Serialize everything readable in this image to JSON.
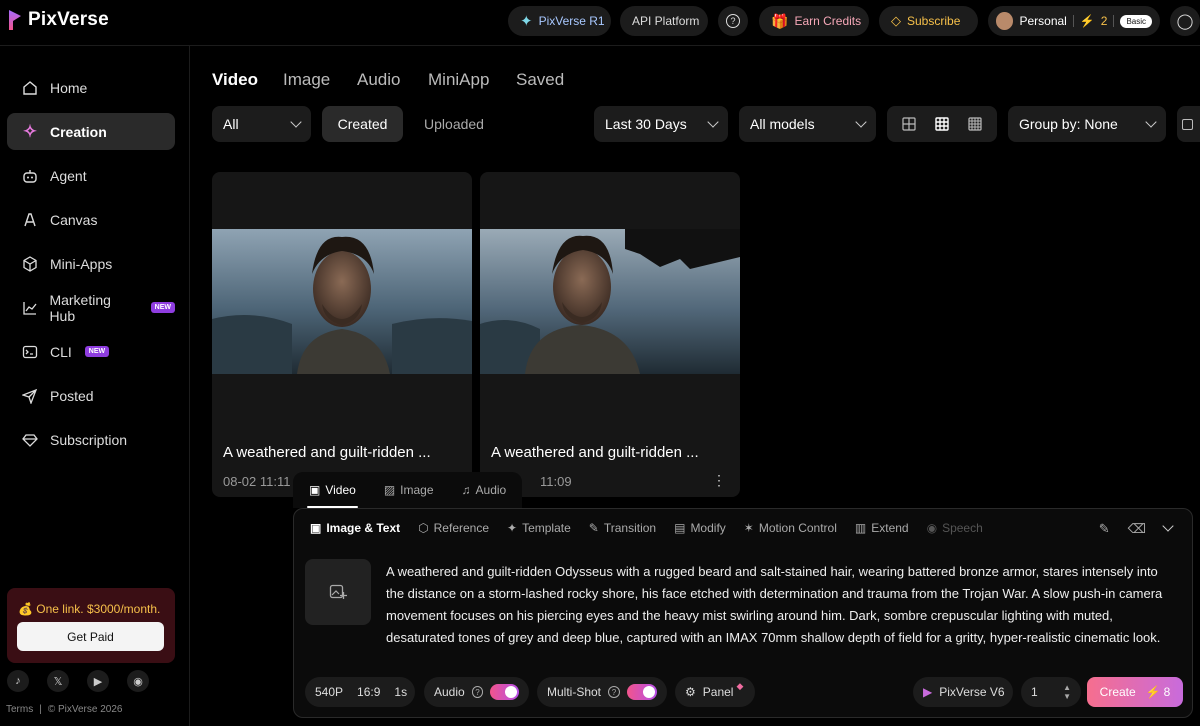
{
  "header": {
    "brand": "PixVerse",
    "r1_label": "PixVerse R1",
    "api_label": "API Platform",
    "help_label": "?",
    "earn_label": "Earn Credits",
    "subscribe_label": "Subscribe",
    "account_label": "Personal",
    "credits": "2",
    "plan_badge": "Basic"
  },
  "sidebar": {
    "items": [
      {
        "label": "Home",
        "icon": "home-icon"
      },
      {
        "label": "Creation",
        "icon": "sparkle-icon"
      },
      {
        "label": "Agent",
        "icon": "robot-icon"
      },
      {
        "label": "Canvas",
        "icon": "canvas-icon"
      },
      {
        "label": "Mini-Apps",
        "icon": "cube-icon"
      },
      {
        "label": "Marketing Hub",
        "icon": "chart-icon",
        "badge": "NEW"
      },
      {
        "label": "CLI",
        "icon": "terminal-icon",
        "badge": "NEW"
      },
      {
        "label": "Posted",
        "icon": "send-icon"
      },
      {
        "label": "Subscription",
        "icon": "diamond-icon"
      }
    ],
    "promo_text": "💰 One link. $3000/month.",
    "promo_button": "Get Paid",
    "socials": [
      "tiktok-icon",
      "x-icon",
      "youtube-icon",
      "discord-icon"
    ],
    "terms": "Terms",
    "copyright": "© PixVerse 2026"
  },
  "tabs": [
    "Video",
    "Image",
    "Audio",
    "MiniApp",
    "Saved"
  ],
  "filters": {
    "type_select": "All",
    "created": "Created",
    "uploaded": "Uploaded",
    "date_range": "Last 30 Days",
    "models": "All models",
    "group_by": "Group by: None"
  },
  "cards": [
    {
      "title": "A weathered and guilt-ridden ...",
      "meta": "08-02  11:11"
    },
    {
      "title": "A weathered and guilt-ridden ...",
      "meta": "11:09"
    }
  ],
  "panel": {
    "tabs": [
      "Video",
      "Image",
      "Audio"
    ],
    "modes": [
      "Image & Text",
      "Reference",
      "Template",
      "Transition",
      "Modify",
      "Motion Control",
      "Extend",
      "Speech"
    ],
    "prompt": "A weathered and guilt-ridden Odysseus with a rugged beard and salt-stained hair, wearing battered bronze armor, stares intensely into the distance on a storm-lashed rocky shore, his face etched with determination and trauma from the Trojan War. A slow push-in camera movement focuses on his piercing eyes and the heavy mist swirling around him. Dark, sombre crepuscular lighting with muted, desaturated tones of grey and deep blue, captured with an IMAX 70mm shallow depth of field for a gritty, hyper-realistic cinematic look.",
    "resolution": "540P",
    "aspect": "16:9",
    "duration": "1s",
    "audio_label": "Audio",
    "multishot_label": "Multi-Shot",
    "panel_label": "Panel",
    "model": "PixVerse V6",
    "count": "1",
    "create_label": "Create",
    "create_cost": "8"
  },
  "colors": {
    "accent_gradient_start": "#f66e8e",
    "accent_gradient_end": "#c86bdc",
    "promo_bg": "#3a0e14",
    "promo_text": "#f6c04a"
  }
}
